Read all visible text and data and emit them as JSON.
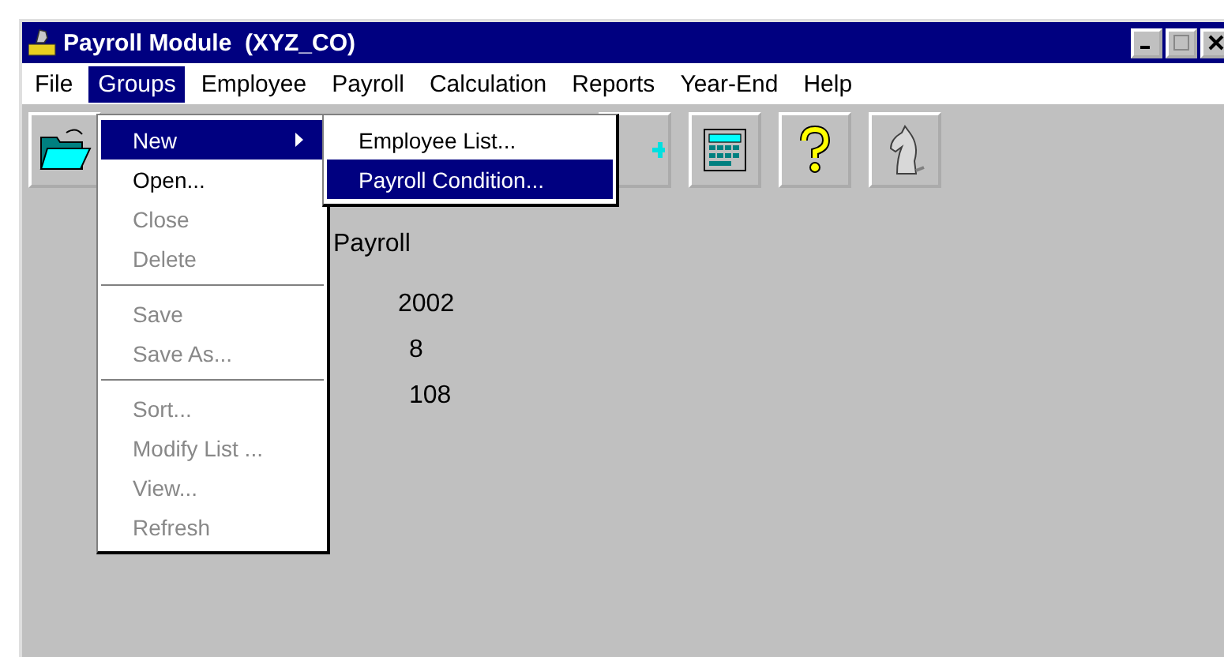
{
  "window": {
    "title": "Payroll Module  (XYZ_CO)"
  },
  "menu_bar": [
    {
      "label": "File",
      "selected": false
    },
    {
      "label": "Groups",
      "selected": true
    },
    {
      "label": "Employee",
      "selected": false
    },
    {
      "label": "Payroll",
      "selected": false
    },
    {
      "label": "Calculation",
      "selected": false
    },
    {
      "label": "Reports",
      "selected": false
    },
    {
      "label": "Year-End",
      "selected": false
    },
    {
      "label": "Help",
      "selected": false
    }
  ],
  "groups_menu": [
    {
      "kind": "item",
      "label": "New",
      "disabled": false,
      "selected": true,
      "submenu": true
    },
    {
      "kind": "item",
      "label": "Open...",
      "disabled": false,
      "selected": false,
      "submenu": false
    },
    {
      "kind": "item",
      "label": "Close",
      "disabled": true,
      "selected": false,
      "submenu": false
    },
    {
      "kind": "item",
      "label": "Delete",
      "disabled": true,
      "selected": false,
      "submenu": false
    },
    {
      "kind": "separator"
    },
    {
      "kind": "item",
      "label": "Save",
      "disabled": true,
      "selected": false,
      "submenu": false
    },
    {
      "kind": "item",
      "label": "Save As...",
      "disabled": true,
      "selected": false,
      "submenu": false
    },
    {
      "kind": "separator"
    },
    {
      "kind": "item",
      "label": "Sort...",
      "disabled": true,
      "selected": false,
      "submenu": false
    },
    {
      "kind": "item",
      "label": "Modify List ...",
      "disabled": true,
      "selected": false,
      "submenu": false
    },
    {
      "kind": "item",
      "label": "View...",
      "disabled": true,
      "selected": false,
      "submenu": false
    },
    {
      "kind": "item",
      "label": "Refresh",
      "disabled": true,
      "selected": false,
      "submenu": false
    }
  ],
  "new_submenu": [
    {
      "label": "Employee List...",
      "selected": false
    },
    {
      "label": "Payroll Condition...",
      "selected": true
    }
  ],
  "content": {
    "heading": "Payroll",
    "values": [
      "2002",
      "8",
      "108"
    ]
  }
}
